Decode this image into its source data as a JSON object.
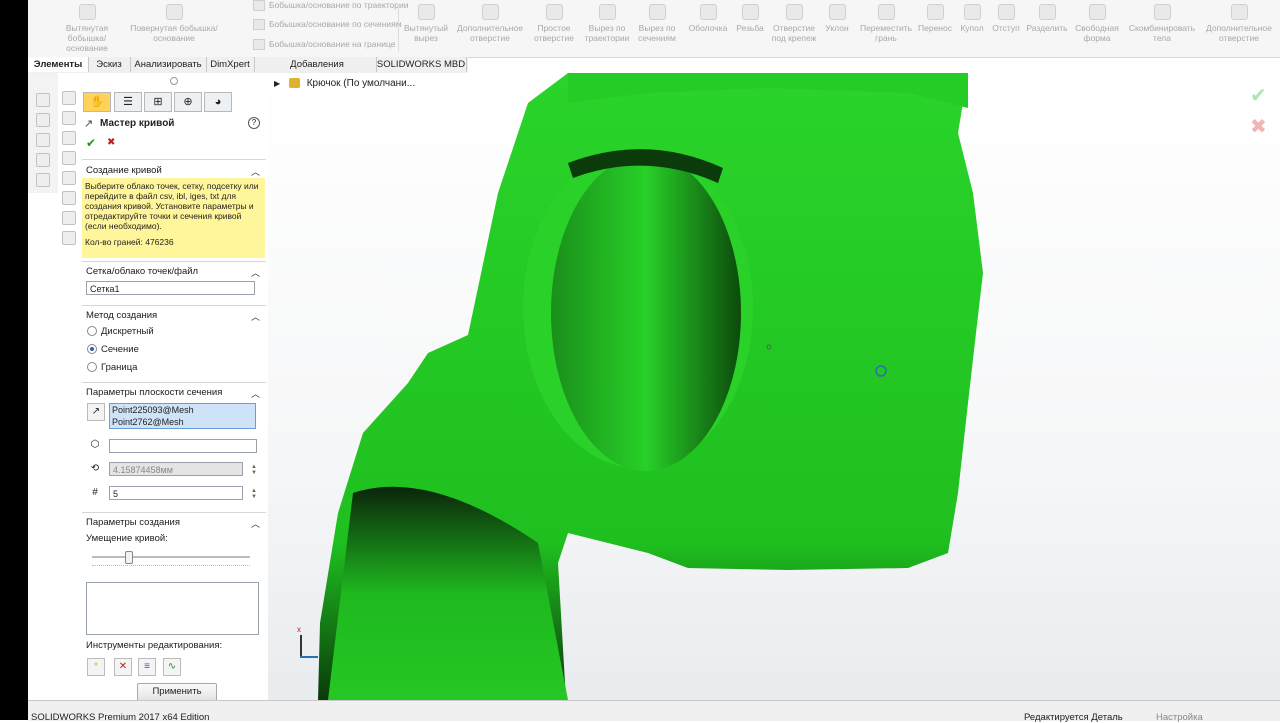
{
  "ribbon": {
    "items": [
      {
        "label": "Вытянутая бобышка/основание",
        "icon": "extrude-boss-icon"
      },
      {
        "label": "Повернутая бобышка/основание",
        "icon": "revolve-boss-icon"
      },
      {
        "label": "Вытянутый вырез",
        "icon": "extrude-cut-icon"
      },
      {
        "label": "Дополнительное отверстие",
        "icon": "hole-wizard-icon"
      },
      {
        "label": "Простое отверстие",
        "icon": "simple-hole-icon"
      },
      {
        "label": "Вырез по траектории",
        "icon": "swept-cut-icon"
      },
      {
        "label": "Вырез по сечениям",
        "icon": "lofted-cut-icon"
      },
      {
        "label": "Оболочка",
        "icon": "shell-icon"
      },
      {
        "label": "Резьба",
        "icon": "thread-icon"
      },
      {
        "label": "Отверстие под крепеж",
        "icon": "fastener-hole-icon"
      },
      {
        "label": "Уклон",
        "icon": "draft-icon"
      },
      {
        "label": "Переместить грань",
        "icon": "move-face-icon"
      },
      {
        "label": "Перенос",
        "icon": "move-copy-icon"
      },
      {
        "label": "Купол",
        "icon": "dome-icon"
      },
      {
        "label": "Отступ",
        "icon": "indent-icon"
      },
      {
        "label": "Разделить",
        "icon": "split-icon"
      },
      {
        "label": "Свободная форма",
        "icon": "freeform-icon"
      },
      {
        "label": "Скомбинировать тела",
        "icon": "combine-icon"
      },
      {
        "label": "Дополнительное отверстие",
        "icon": "hole-wizard-icon"
      }
    ],
    "small_items": [
      "Бобышка/основание по траектории",
      "Бобышка/основание по сечениям",
      "Бобышка/основание на границе"
    ]
  },
  "tabs": [
    "Элементы",
    "Эскиз",
    "Анализировать",
    "DimXpert",
    "Добавления SOLIDWORKS",
    "SOLIDWORKS MBD"
  ],
  "panel": {
    "title": "Мастер кривой",
    "help": "?",
    "ok": "✔",
    "cancel": "✖",
    "section_create": "Создание кривой",
    "message": "Выберите облако точек, сетку, подсетку или перейдите в файл csv, ibl, iges, txt для создания кривой. Установите параметры и отредактируйте точки и сечения кривой (если необходимо).",
    "faces": "Кол-во граней: 476236",
    "section_mesh": "Сетка/облако точек/файл",
    "mesh_value": "Сетка1",
    "section_method": "Метод создания",
    "methods": [
      "Дискретный",
      "Сечение",
      "Граница"
    ],
    "method_selected": 1,
    "section_plane": "Параметры плоскости сечения",
    "points": [
      "Point225093@Mesh",
      "Point2762@Mesh"
    ],
    "distance": "4.15874458мм",
    "count": "5",
    "section_params": "Параметры создания",
    "fit_label": "Умещение кривой:",
    "fit_value": 0.3,
    "tools_label": "Инструменты редактирования:",
    "apply": "Применить"
  },
  "tree": {
    "label": "Крючок  (По умолчани..."
  },
  "status": {
    "left": "SOLIDWORKS Premium 2017 x64 Edition",
    "middle": "Редактируется Деталь",
    "right": "Настройка"
  },
  "colors": {
    "model": "#22cc22",
    "message_bg": "#fff59a",
    "accent": "#2a5fb5"
  }
}
